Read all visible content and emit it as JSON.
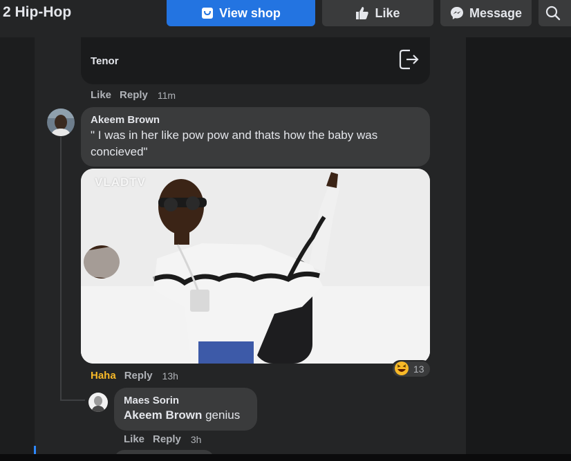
{
  "header": {
    "page_name": "2 Hip-Hop",
    "buttons": {
      "view_shop": "View shop",
      "like": "Like",
      "message": "Message"
    }
  },
  "comments": {
    "prev": {
      "attachment_source": "Tenor",
      "actions": {
        "like": "Like",
        "reply": "Reply",
        "time": "11m"
      }
    },
    "main": {
      "author": "Akeem Brown",
      "text": "\" I was in her like pow pow and thats how the baby was concieved\"",
      "gif_watermark": "VLADTV",
      "actions": {
        "reaction_label": "Haha",
        "reply": "Reply",
        "time": "13h"
      },
      "reaction_count": "13",
      "reaction_icon": "haha-emoji-icon"
    },
    "reply": {
      "author": "Maes Sorin",
      "mention": "Akeem Brown",
      "text": " genius",
      "actions": {
        "like": "Like",
        "reply": "Reply",
        "time": "3h"
      }
    }
  },
  "colors": {
    "accent": "#2374e1",
    "haha": "#f7b928",
    "bubble": "#3a3b3c",
    "panel": "#242526"
  }
}
